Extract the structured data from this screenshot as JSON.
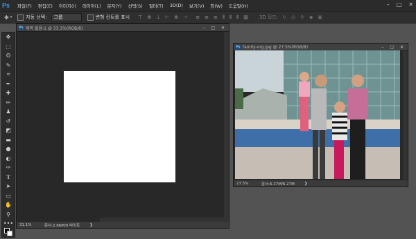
{
  "app": {
    "logo": "Ps"
  },
  "menu": [
    "파일(F)",
    "편집(E)",
    "이미지(I)",
    "레이어(L)",
    "문자(Y)",
    "선택(S)",
    "필터(T)",
    "3D(D)",
    "보기(V)",
    "창(W)",
    "도움말(H)"
  ],
  "window_controls": [
    "–",
    "□",
    "✕"
  ],
  "options": {
    "auto_select_label": "자동 선택:",
    "auto_select_value": "그룹",
    "transform_label": "변형 컨트롤 표시",
    "mode_3d_label": "3D 모드:"
  },
  "documents": [
    {
      "title": "제목 없음-1 @ 33.3%(RGB/8)",
      "controls": [
        "–",
        "□",
        "✕"
      ],
      "status": {
        "zoom": "31.1%",
        "doc": "문서:2.86M/0 바이트",
        "arrow": "❯"
      }
    },
    {
      "title": "family-org.jpg @ 27.5%(RGB/8)",
      "controls": [
        "–",
        "□",
        "✕"
      ],
      "status": {
        "zoom": "27.5%",
        "doc": "문서:6.27M/6.27M",
        "arrow": "❯"
      }
    }
  ],
  "colors": {
    "foreground": "#000000",
    "background": "#ffffff",
    "accent": "#3d9bf0"
  },
  "tools": [
    "move-tool",
    "marquee-tool",
    "lasso-tool",
    "quick-select-tool",
    "crop-tool",
    "eyedropper-tool",
    "healing-tool",
    "brush-tool",
    "stamp-tool",
    "history-brush-tool",
    "eraser-tool",
    "gradient-tool",
    "blur-tool",
    "dodge-tool",
    "pen-tool",
    "type-tool",
    "path-select-tool",
    "shape-tool",
    "hand-tool",
    "zoom-tool",
    "more-tools"
  ]
}
